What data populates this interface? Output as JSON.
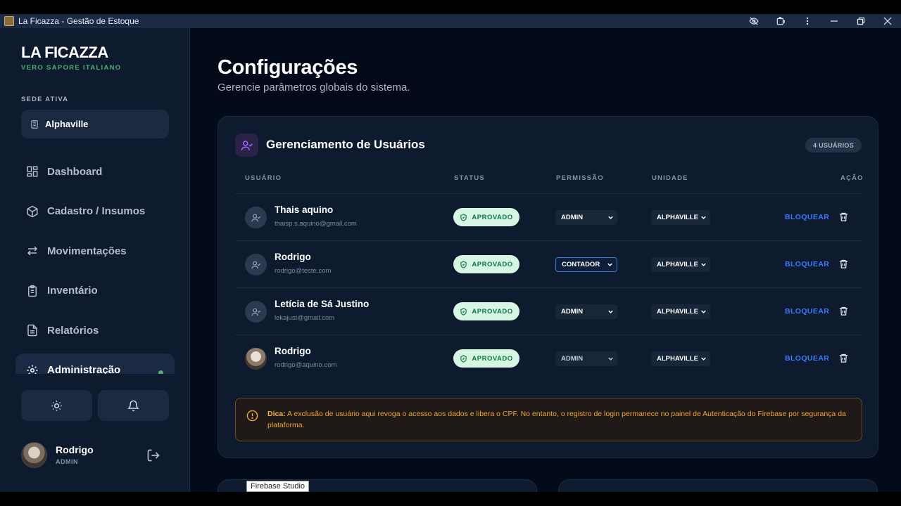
{
  "window": {
    "title": "La Ficazza - Gestão de Estoque"
  },
  "sidebar": {
    "brand": "LA FICAZZA",
    "brand_sub": "VERO SAPORE ITALIANO",
    "sede_label": "SEDE ATIVA",
    "sede_value": "Alphaville",
    "items": [
      {
        "label": "Dashboard",
        "icon": "dashboard-icon"
      },
      {
        "label": "Cadastro / Insumos",
        "icon": "box-icon"
      },
      {
        "label": "Movimentações",
        "icon": "arrows-icon"
      },
      {
        "label": "Inventário",
        "icon": "clipboard-icon"
      },
      {
        "label": "Relatórios",
        "icon": "report-icon"
      },
      {
        "label": "Administração",
        "icon": "gear-icon",
        "active": true
      }
    ],
    "user": {
      "name": "Rodrigo",
      "role": "ADMIN"
    }
  },
  "page": {
    "title": "Configurações",
    "subtitle": "Gerencie parâmetros globais do sistema."
  },
  "users_card": {
    "title": "Gerenciamento de Usuários",
    "count": "4 USUÁRIOS",
    "columns": {
      "user": "USUÁRIO",
      "status": "STATUS",
      "permission": "PERMISSÃO",
      "unit": "UNIDADE",
      "action": "AÇÃO"
    },
    "rows": [
      {
        "name": "Thais aquino",
        "email": "thaisp.s.aquino@gmail.com",
        "status": "APROVADO",
        "permission": "ADMIN",
        "unit": "ALPHAVILLE",
        "action": "BLOQUEAR"
      },
      {
        "name": "Rodrigo",
        "email": "rodrigo@teste.com",
        "status": "APROVADO",
        "permission": "CONTADOR",
        "unit": "ALPHAVILLE",
        "action": "BLOQUEAR"
      },
      {
        "name": "Letícia de Sá Justino",
        "email": "lekajust@gmail.com",
        "status": "APROVADO",
        "permission": "ADMIN",
        "unit": "ALPHAVILLE",
        "action": "BLOQUEAR"
      },
      {
        "name": "Rodrigo",
        "email": "rodrigo@aquino.com",
        "status": "APROVADO",
        "permission": "ADMIN",
        "unit": "ALPHAVILLE",
        "action": "BLOQUEAR"
      }
    ],
    "tip_label": "Dica:",
    "tip_text": " A exclusão de usuário aqui revoga o acesso aos dados e libera o CPF. No entanto, o registro de login permanece no painel de Autenticação do Firebase por segurança da plataforma."
  },
  "tooltip": "Firebase Studio",
  "colors": {
    "accent": "#3a7bff",
    "success": "#0b7a3e",
    "brand_green": "#4caf6a",
    "warning": "#f0a33a"
  }
}
